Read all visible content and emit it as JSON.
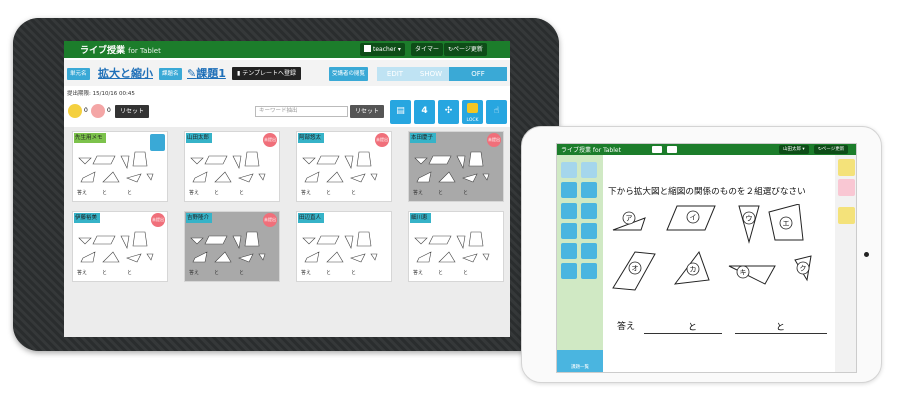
{
  "teacher": {
    "app_title": "ライブ授業",
    "app_subtitle": "for Tablet",
    "user_button": "teacher",
    "timer_button": "タイマー",
    "refresh_button": "ページ更新",
    "unit_tag": "単元名",
    "unit_title": "拡大と縮小",
    "task_tag": "課題名",
    "task_title": "課題1",
    "template_button": "テンプレートへ登録",
    "viewer_mode_label": "受講者の閲覧",
    "mode_edit": "EDIT",
    "mode_show": "SHOW",
    "mode_off": "OFF",
    "deadline": "提出期限: 15/10/16 00:45",
    "count_a": "0",
    "count_b": "0",
    "reset_button": "リセット",
    "search_placeholder": "キーワード抽出",
    "search_reset": "リセット",
    "layout_count": "4",
    "lock_label": "LOCK",
    "cards": [
      {
        "name": "先生用メモ",
        "gray": false,
        "note": true
      },
      {
        "name": "山田太郎",
        "gray": false,
        "badge": "未提出"
      },
      {
        "name": "阿部悠太",
        "gray": false,
        "badge": "未提出"
      },
      {
        "name": "本田慶子",
        "gray": true,
        "badge": "未提出"
      },
      {
        "name": "伊藤裕美",
        "gray": false,
        "badge": "未提出"
      },
      {
        "name": "吉野隆介",
        "gray": true,
        "badge": "未提出"
      },
      {
        "name": "田辺直人",
        "gray": false,
        "badge": ""
      },
      {
        "name": "細川恵",
        "gray": false,
        "badge": ""
      }
    ],
    "card_answer": "答え　　　と　　　　と"
  },
  "student": {
    "app_title": "ライブ授業 for Tablet",
    "user_button": "山田太郎",
    "refresh_button": "ページ更新",
    "question": "下から拡大図と縮図の関係のものを２組選びなさい",
    "shape_labels": [
      "ア",
      "イ",
      "ウ",
      "エ",
      "オ",
      "カ",
      "キ",
      "ク"
    ],
    "answer_label": "答え",
    "answer_and": "と",
    "task_list_button": "課題一覧"
  },
  "colors": {
    "header_green": "#1c7d2b",
    "accent_blue": "#27a6e0",
    "badge_red": "#f06f7a",
    "name_teal": "#36b3c8"
  }
}
